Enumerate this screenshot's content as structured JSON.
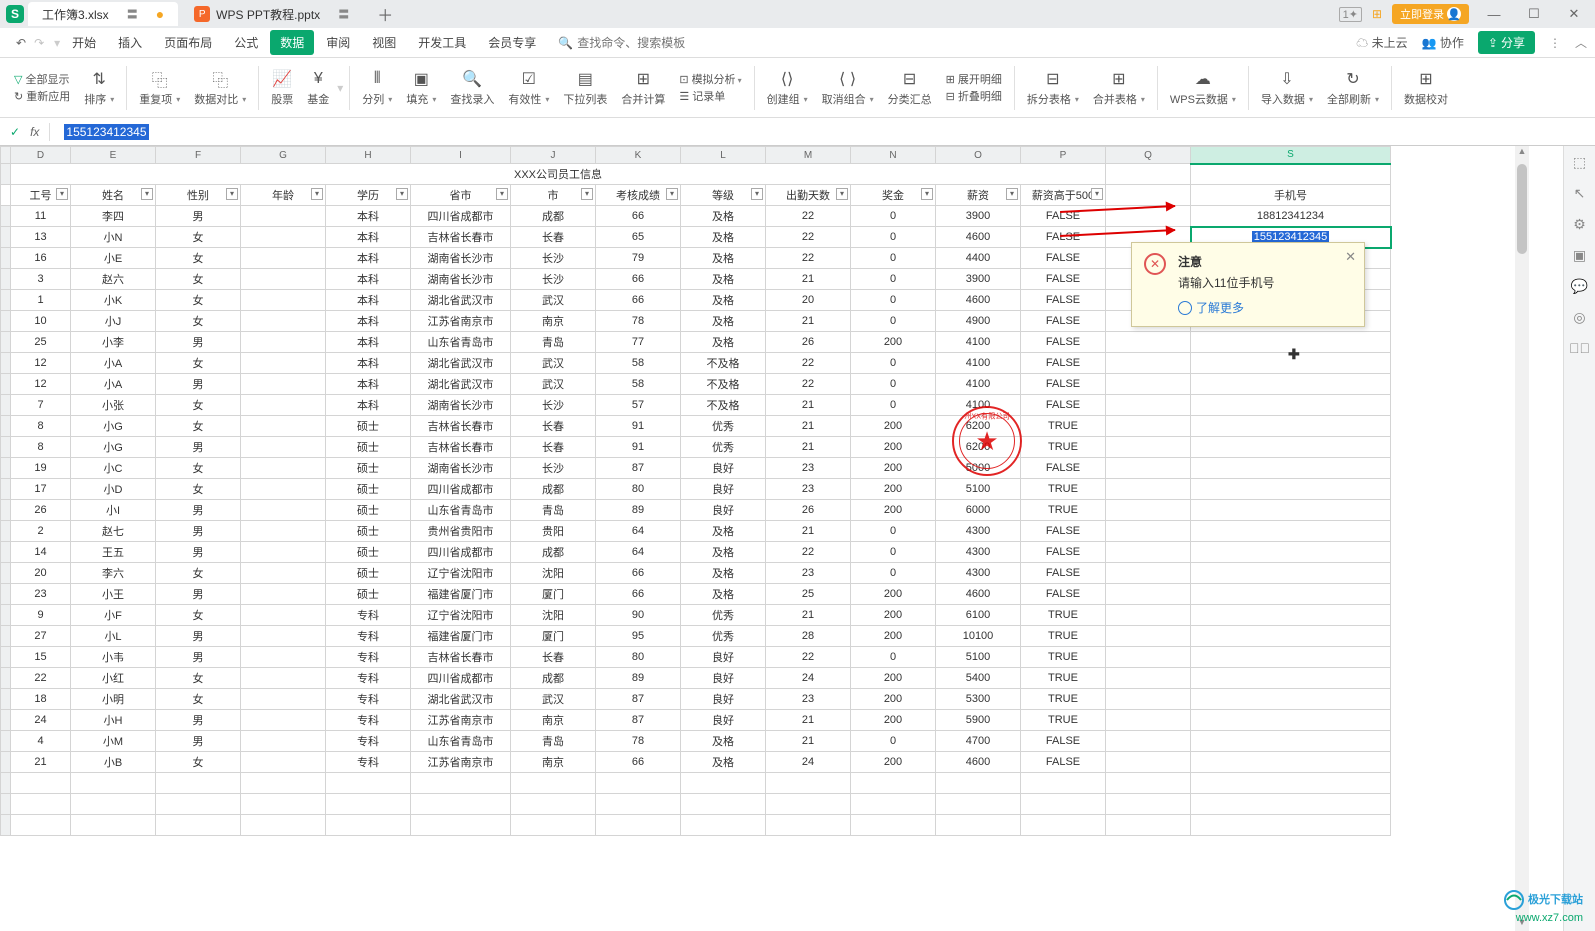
{
  "titlebar": {
    "tab1": "工作簿3.xlsx",
    "tab2": "WPS PPT教程.pptx",
    "login": "立即登录"
  },
  "menubar": {
    "items": [
      "开始",
      "插入",
      "页面布局",
      "公式",
      "数据",
      "审阅",
      "视图",
      "开发工具",
      "会员专享"
    ],
    "search_placeholder": "查找命令、搜索模板",
    "not_uploaded": "未上云",
    "coop": "协作",
    "share": "分享"
  },
  "ribbon": {
    "g0a": "全部显示",
    "g0b": "重新应用",
    "g1": "排序",
    "g2": "重复项",
    "g3": "数据对比",
    "g4": "股票",
    "g5": "基金",
    "g6": "分列",
    "g7": "填充",
    "g8": "查找录入",
    "g9": "有效性",
    "g10": "下拉列表",
    "g11": "合并计算",
    "g11a": "模拟分析",
    "g11b": "记录单",
    "g12": "创建组",
    "g13": "取消组合",
    "g14": "分类汇总",
    "g14a": "展开明细",
    "g14b": "折叠明细",
    "g15": "拆分表格",
    "g16": "合并表格",
    "g17": "WPS云数据",
    "g18": "导入数据",
    "g19": "全部刷新",
    "g20": "数据校对"
  },
  "formula_value": "155123412345",
  "sheet": {
    "title": "XXX公司员工信息",
    "col_letters": [
      "",
      "D",
      "E",
      "F",
      "G",
      "H",
      "I",
      "J",
      "K",
      "L",
      "M",
      "N",
      "O",
      "P",
      "Q",
      "S"
    ],
    "headers": [
      "工号",
      "姓名",
      "性别",
      "年龄",
      "学历",
      "省市",
      "市",
      "考核成绩",
      "等级",
      "出勤天数",
      "奖金",
      "薪资",
      "薪资高于500",
      "",
      "手机号"
    ],
    "phone1": "18812341234",
    "phone2": "155123412345",
    "rows": [
      [
        "11",
        "李四",
        "男",
        "",
        "本科",
        "四川省成都市",
        "成都",
        "66",
        "及格",
        "22",
        "0",
        "3900",
        "FALSE"
      ],
      [
        "13",
        "小N",
        "女",
        "",
        "本科",
        "吉林省长春市",
        "长春",
        "65",
        "及格",
        "22",
        "0",
        "4600",
        "FALSE"
      ],
      [
        "16",
        "小E",
        "女",
        "",
        "本科",
        "湖南省长沙市",
        "长沙",
        "79",
        "及格",
        "22",
        "0",
        "4400",
        "FALSE"
      ],
      [
        "3",
        "赵六",
        "女",
        "",
        "本科",
        "湖南省长沙市",
        "长沙",
        "66",
        "及格",
        "21",
        "0",
        "3900",
        "FALSE"
      ],
      [
        "1",
        "小K",
        "女",
        "",
        "本科",
        "湖北省武汉市",
        "武汉",
        "66",
        "及格",
        "20",
        "0",
        "4600",
        "FALSE"
      ],
      [
        "10",
        "小J",
        "女",
        "",
        "本科",
        "江苏省南京市",
        "南京",
        "78",
        "及格",
        "21",
        "0",
        "4900",
        "FALSE"
      ],
      [
        "25",
        "小李",
        "男",
        "",
        "本科",
        "山东省青岛市",
        "青岛",
        "77",
        "及格",
        "26",
        "200",
        "4100",
        "FALSE"
      ],
      [
        "12",
        "小A",
        "女",
        "",
        "本科",
        "湖北省武汉市",
        "武汉",
        "58",
        "不及格",
        "22",
        "0",
        "4100",
        "FALSE"
      ],
      [
        "12",
        "小A",
        "男",
        "",
        "本科",
        "湖北省武汉市",
        "武汉",
        "58",
        "不及格",
        "22",
        "0",
        "4100",
        "FALSE"
      ],
      [
        "7",
        "小张",
        "女",
        "",
        "本科",
        "湖南省长沙市",
        "长沙",
        "57",
        "不及格",
        "21",
        "0",
        "4100",
        "FALSE"
      ],
      [
        "8",
        "小G",
        "女",
        "",
        "硕士",
        "吉林省长春市",
        "长春",
        "91",
        "优秀",
        "21",
        "200",
        "6200",
        "TRUE"
      ],
      [
        "8",
        "小G",
        "男",
        "",
        "硕士",
        "吉林省长春市",
        "长春",
        "91",
        "优秀",
        "21",
        "200",
        "6200",
        "TRUE"
      ],
      [
        "19",
        "小C",
        "女",
        "",
        "硕士",
        "湖南省长沙市",
        "长沙",
        "87",
        "良好",
        "23",
        "200",
        "5000",
        "FALSE"
      ],
      [
        "17",
        "小D",
        "女",
        "",
        "硕士",
        "四川省成都市",
        "成都",
        "80",
        "良好",
        "23",
        "200",
        "5100",
        "TRUE"
      ],
      [
        "26",
        "小I",
        "男",
        "",
        "硕士",
        "山东省青岛市",
        "青岛",
        "89",
        "良好",
        "26",
        "200",
        "6000",
        "TRUE"
      ],
      [
        "2",
        "赵七",
        "男",
        "",
        "硕士",
        "贵州省贵阳市",
        "贵阳",
        "64",
        "及格",
        "21",
        "0",
        "4300",
        "FALSE"
      ],
      [
        "14",
        "王五",
        "男",
        "",
        "硕士",
        "四川省成都市",
        "成都",
        "64",
        "及格",
        "22",
        "0",
        "4300",
        "FALSE"
      ],
      [
        "20",
        "李六",
        "女",
        "",
        "硕士",
        "辽宁省沈阳市",
        "沈阳",
        "66",
        "及格",
        "23",
        "0",
        "4300",
        "FALSE"
      ],
      [
        "23",
        "小王",
        "男",
        "",
        "硕士",
        "福建省厦门市",
        "厦门",
        "66",
        "及格",
        "25",
        "200",
        "4600",
        "FALSE"
      ],
      [
        "9",
        "小F",
        "女",
        "",
        "专科",
        "辽宁省沈阳市",
        "沈阳",
        "90",
        "优秀",
        "21",
        "200",
        "6100",
        "TRUE"
      ],
      [
        "27",
        "小L",
        "男",
        "",
        "专科",
        "福建省厦门市",
        "厦门",
        "95",
        "优秀",
        "28",
        "200",
        "10100",
        "TRUE"
      ],
      [
        "15",
        "小韦",
        "男",
        "",
        "专科",
        "吉林省长春市",
        "长春",
        "80",
        "良好",
        "22",
        "0",
        "5100",
        "TRUE"
      ],
      [
        "22",
        "小红",
        "女",
        "",
        "专科",
        "四川省成都市",
        "成都",
        "89",
        "良好",
        "24",
        "200",
        "5400",
        "TRUE"
      ],
      [
        "18",
        "小明",
        "女",
        "",
        "专科",
        "湖北省武汉市",
        "武汉",
        "87",
        "良好",
        "23",
        "200",
        "5300",
        "TRUE"
      ],
      [
        "24",
        "小H",
        "男",
        "",
        "专科",
        "江苏省南京市",
        "南京",
        "87",
        "良好",
        "21",
        "200",
        "5900",
        "TRUE"
      ],
      [
        "4",
        "小M",
        "男",
        "",
        "专科",
        "山东省青岛市",
        "青岛",
        "78",
        "及格",
        "21",
        "0",
        "4700",
        "FALSE"
      ],
      [
        "21",
        "小B",
        "女",
        "",
        "专科",
        "江苏省南京市",
        "南京",
        "66",
        "及格",
        "24",
        "200",
        "4600",
        "FALSE"
      ]
    ]
  },
  "tooltip": {
    "title": "注意",
    "msg": "请输入11位手机号",
    "link": "了解更多"
  },
  "watermark": {
    "line1": "极光下载站",
    "line2": "www.xz7.com"
  }
}
